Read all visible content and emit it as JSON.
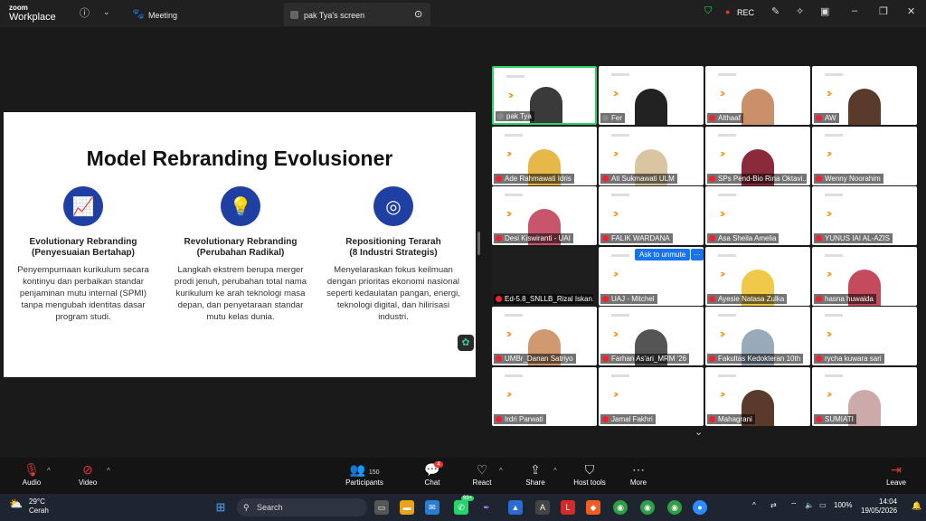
{
  "app": {
    "brand_top": "zoom",
    "brand_bottom": "Workplace",
    "meeting_tab": "Meeting",
    "share_tab": "pak Tya's screen",
    "rec": "REC"
  },
  "slide": {
    "title": "Model Rebranding Evolusioner",
    "columns": [
      {
        "icon": "chart-growth-icon",
        "heading": "Evolutionary Rebranding",
        "sub": "(Penyesuaian Bertahap)",
        "body": "Penyempurnaan kurikulum secara kontinyu dan perbaikan standar penjaminan mutu internal (SPMI) tanpa mengubah identitas dasar program studi."
      },
      {
        "icon": "lightbulb-icon",
        "heading": "Revolutionary Rebranding",
        "sub": "(Perubahan Radikal)",
        "body": "Langkah ekstrem berupa merger prodi jenuh, perubahan total nama kurikulum ke arah teknologi masa depan, dan penyetaraan standar mutu kelas dunia."
      },
      {
        "icon": "target-icon",
        "heading": "Repositioning Terarah",
        "sub": "(8 Industri Strategis)",
        "body": "Menyelaraskan fokus keilmuan dengan prioritas ekonomi nasional seperti kedaulatan pangan, energi, teknologi digital, dan hilirisasi industri."
      }
    ]
  },
  "participants": [
    {
      "name": "pak Tya",
      "mic": false
    },
    {
      "name": "Fer",
      "mic": false
    },
    {
      "name": "Althaaf",
      "mic": true
    },
    {
      "name": "AW",
      "mic": true
    },
    {
      "name": "Ade Rahmawati Idris",
      "mic": true
    },
    {
      "name": "Ati Sukmawati ULM",
      "mic": true
    },
    {
      "name": "SPs Pend-Bio Rina Oktavi...",
      "mic": true
    },
    {
      "name": "Wenny Noorahim",
      "mic": true
    },
    {
      "name": "Desi Kiswiranti - UAI",
      "mic": true
    },
    {
      "name": "FALIK WARDANA",
      "mic": true
    },
    {
      "name": "Asa Sheila Amelia",
      "mic": true
    },
    {
      "name": "YUNUS IAI AL-AZIS",
      "mic": true
    },
    {
      "name": "Ed-5.8_SNLLB_Rizal Iskan...",
      "mic": true
    },
    {
      "name": "UAJ - Mitchel",
      "mic": true
    },
    {
      "name": "Ayesie Natasa Zulka",
      "mic": true
    },
    {
      "name": "hasna huwaida",
      "mic": true
    },
    {
      "name": "UMBr_Danan Satriyo",
      "mic": true
    },
    {
      "name": "Farhan As'ari_MRM '26",
      "mic": true
    },
    {
      "name": "Fakultas Kedokteran 10th",
      "mic": true
    },
    {
      "name": "rycha kuwara sari",
      "mic": true
    },
    {
      "name": "Irdri Parwati",
      "mic": true
    },
    {
      "name": "Jamal Fakhri",
      "mic": true
    },
    {
      "name": "Mahagrani",
      "mic": true
    },
    {
      "name": "SUMIATI",
      "mic": true
    }
  ],
  "ask_unmute": "Ask to unmute",
  "toolbar": {
    "audio": "Audio",
    "video": "Video",
    "participants": "Participants",
    "participants_count": "150",
    "chat": "Chat",
    "chat_badge": "4",
    "react": "React",
    "share": "Share",
    "host_tools": "Host tools",
    "more": "More",
    "leave": "Leave"
  },
  "taskbar": {
    "temp": "29°C",
    "weather": "Cerah",
    "search": "Search",
    "badge": "99+",
    "battery": "100%",
    "time": "14:04",
    "date": "19/05/2026"
  }
}
